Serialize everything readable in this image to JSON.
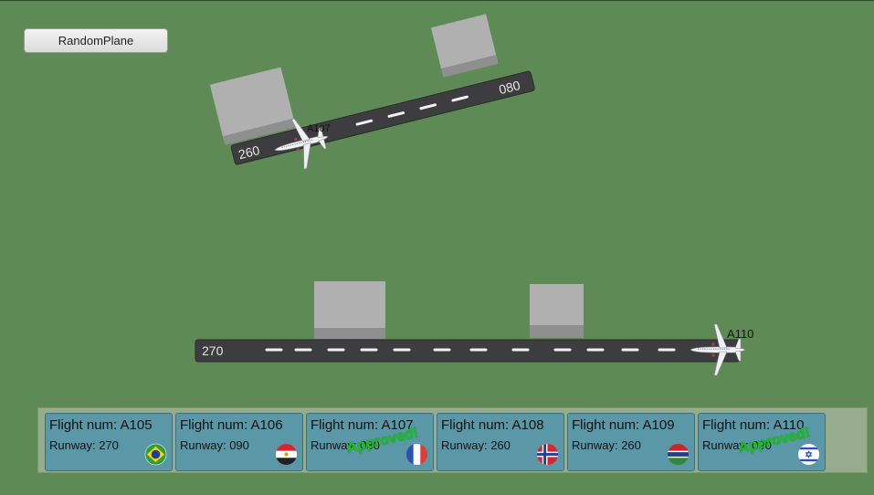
{
  "toolbar": {
    "random_plane_label": "RandomPlane"
  },
  "runway_top": {
    "left_label": "260",
    "right_label": "080",
    "plane_label": "A107"
  },
  "runway_bottom": {
    "left_label": "270",
    "plane_label": "A110"
  },
  "flights": [
    {
      "flight": "Flight num: A105",
      "runway": "Runway: 270",
      "flag": "brazil-flag",
      "approved": ""
    },
    {
      "flight": "Flight num: A106",
      "runway": "Runway: 090",
      "flag": "egypt-flag",
      "approved": ""
    },
    {
      "flight": "Flight num: A107",
      "runway": "Runway: 080",
      "flag": "france-flag",
      "approved": "Approved!"
    },
    {
      "flight": "Flight num: A108",
      "runway": "Runway: 260",
      "flag": "norway-flag",
      "approved": ""
    },
    {
      "flight": "Flight num: A109",
      "runway": "Runway: 260",
      "flag": "gambia-flag",
      "approved": ""
    },
    {
      "flight": "Flight num: A110",
      "runway": "Runway: 090",
      "flag": "israel-flag",
      "approved": "Approved!"
    }
  ],
  "colors": {
    "grass": "#5e8b55",
    "runway": "#3d3d3f",
    "card": "#5a97a7",
    "approved": "#17c21a"
  }
}
